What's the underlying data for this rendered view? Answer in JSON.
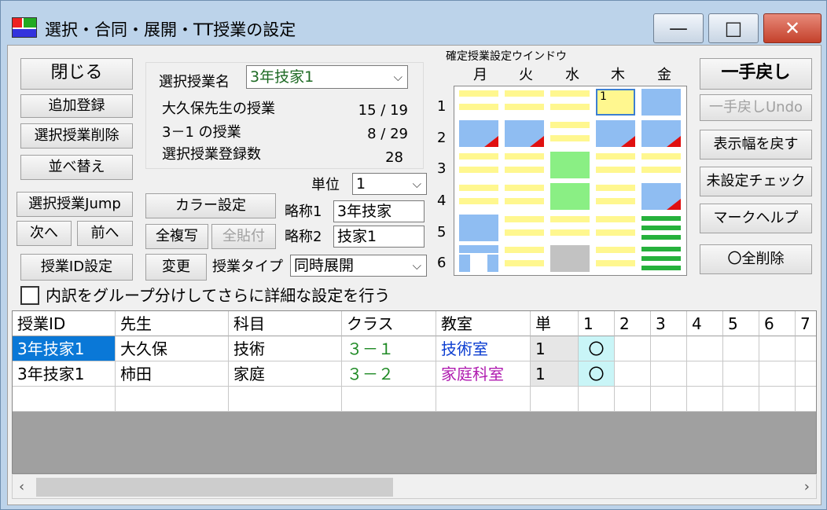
{
  "window": {
    "title": "選択・合同・展開・TT授業の設定",
    "minimize_glyph": "—",
    "maximize_glyph": "□",
    "close_glyph": "✕",
    "accent": "#0a78d7"
  },
  "left_buttons": {
    "close": "閉じる",
    "add": "追加登録",
    "delete": "選択授業削除",
    "sort": "並べ替え",
    "jump": "選択授業Jump",
    "next": "次へ",
    "prev": "前へ",
    "id_setting": "授業ID設定"
  },
  "info_panel": {
    "select_label": "選択授業名",
    "select_value": "3年技家1",
    "teacher_label": "大久保先生の授業",
    "teacher_count": "15 / 19",
    "class_label": "3－1 の授業",
    "class_count": "8 / 29",
    "reg_label": "選択授業登録数",
    "reg_count": "28"
  },
  "middle": {
    "color_setting": "カラー設定",
    "copy_all": "全複写",
    "paste_all": "全貼付",
    "change": "変更",
    "unit_label": "単位",
    "unit_value": "1",
    "abbr1_label": "略称1",
    "abbr1_value": "3年技家",
    "abbr2_label": "略称2",
    "abbr2_value": "技家1",
    "type_label": "授業タイプ",
    "type_value": "同時展開"
  },
  "grid": {
    "title": "確定授業設定ウインドウ",
    "days": [
      "月",
      "火",
      "水",
      "木",
      "金"
    ],
    "periods": [
      "1",
      "2",
      "3",
      "4",
      "5",
      "6"
    ],
    "selected_cell_number": "1"
  },
  "right_buttons": {
    "undo": "一手戻し",
    "redo": "一手戻しUndo",
    "reset_width": "表示幅を戻す",
    "check": "未設定チェック",
    "mark_help": "マークヘルプ",
    "clear_all": "〇全削除"
  },
  "detail_checkbox": {
    "label": "内訳をグループ分けしてさらに詳細な設定を行う",
    "checked": false
  },
  "table": {
    "headers": [
      "授業ID",
      "先生",
      "科目",
      "クラス",
      "教室",
      "単",
      "1",
      "2",
      "3",
      "4",
      "5",
      "6",
      "7"
    ],
    "rows": [
      {
        "id": "3年技家1",
        "teacher": "大久保",
        "subject": "技術",
        "class": "３－１",
        "room": "技術室",
        "unit": "1",
        "p1": "〇"
      },
      {
        "id": "3年技家1",
        "teacher": "柿田",
        "subject": "家庭",
        "class": "３－２",
        "room": "家庭科室",
        "unit": "1",
        "p1": "〇"
      }
    ]
  },
  "scrollbar": {
    "left_arrow": "‹",
    "right_arrow": "›"
  }
}
